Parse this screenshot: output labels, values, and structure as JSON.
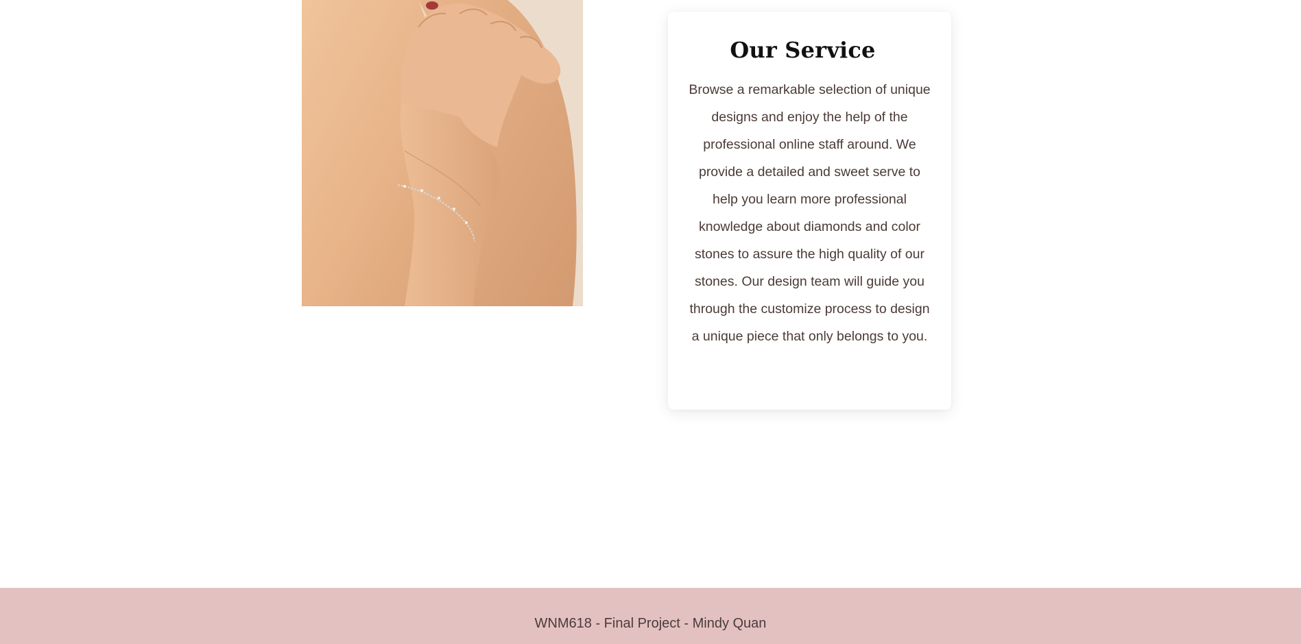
{
  "service": {
    "title": "Our Service",
    "body": "Browse a remarkable selection of unique designs and enjoy the help of the professional online staff around. We provide a detailed and sweet serve to help you learn more professional knowledge about diamonds and color stones to assure the high quality of our stones. Our design team will guide you through the customize process to design a unique piece that only belongs to you."
  },
  "image": {
    "subject": "model-wearing-bracelet"
  },
  "footer": {
    "text": "WNM618 - Final Project - Mindy Quan"
  },
  "colors": {
    "footer_bg": "#e4c1c1",
    "body_text": "#4a3b36",
    "title_text": "#111111",
    "photo_backdrop": "#ecdccb",
    "skin": "#e7b48d"
  }
}
